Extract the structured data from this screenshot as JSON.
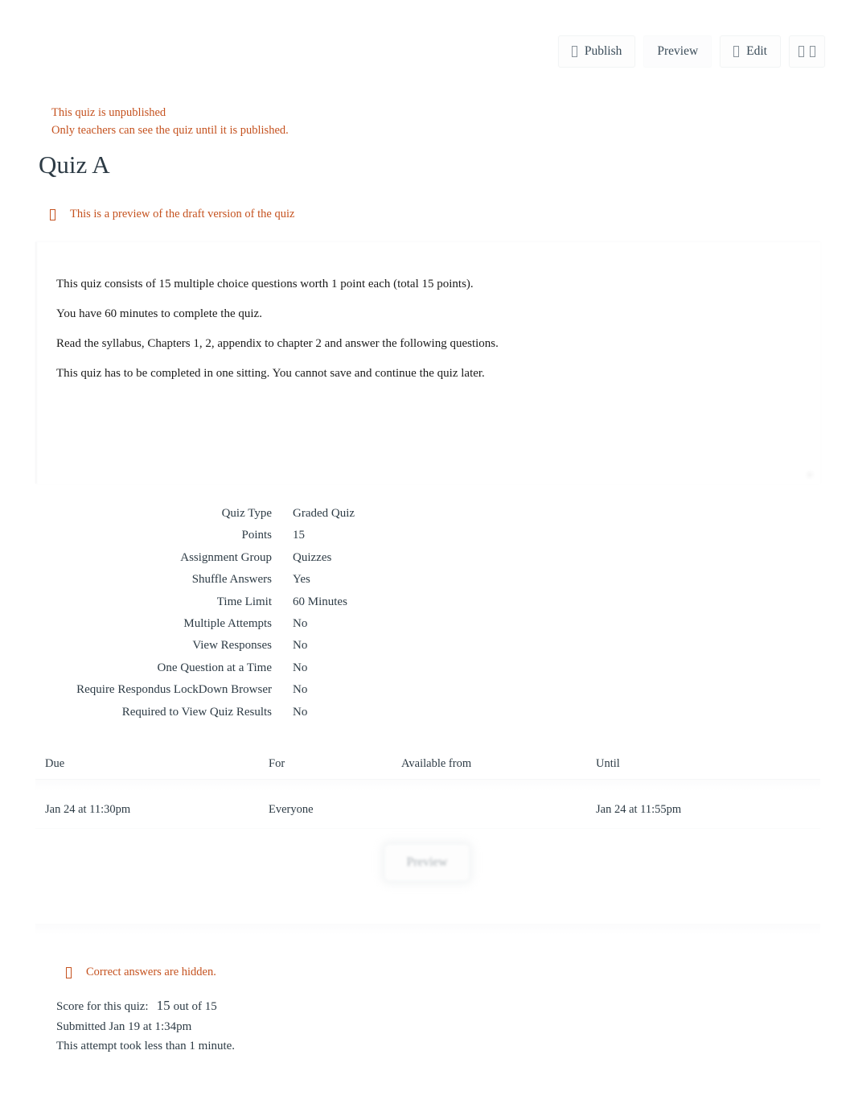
{
  "toolbar": {
    "publish": {
      "label": "Publish",
      "icon": "publish-tofu-icon"
    },
    "preview": {
      "label": "Preview"
    },
    "edit": {
      "label": "Edit",
      "icon": "edit-tofu-icon"
    },
    "overflow": {
      "icon_left": "tofu-icon",
      "icon_right": "tofu-icon"
    }
  },
  "alerts": {
    "unpublished_title": "This quiz is unpublished",
    "unpublished_detail": "Only teachers can see the quiz until it is published.",
    "draft_preview": "This is a preview of the draft version of the quiz",
    "answers_hidden": "Correct answers are hidden.",
    "color": "#c5521f"
  },
  "page_title": "Quiz A",
  "description": [
    "This quiz consists of 15 multiple choice questions worth 1 point each (total 15 points).",
    "You have 60 minutes to complete the quiz.",
    "Read the syllabus, Chapters 1, 2, appendix to chapter 2 and answer the following questions.",
    "This quiz has to be completed in one sitting. You cannot save and continue the quiz later."
  ],
  "details": [
    {
      "label": "Quiz Type",
      "value": "Graded Quiz"
    },
    {
      "label": "Points",
      "value": "15"
    },
    {
      "label": "Assignment Group",
      "value": "Quizzes"
    },
    {
      "label": "Shuffle Answers",
      "value": "Yes"
    },
    {
      "label": "Time Limit",
      "value": "60 Minutes"
    },
    {
      "label": "Multiple Attempts",
      "value": "No"
    },
    {
      "label": "View Responses",
      "value": "No"
    },
    {
      "label": "One Question at a Time",
      "value": "No"
    },
    {
      "label": "Require Respondus LockDown Browser",
      "value": "No"
    },
    {
      "label": "Required to View Quiz Results",
      "value": "No"
    }
  ],
  "dates": {
    "headers": {
      "due": "Due",
      "for": "For",
      "available_from": "Available from",
      "until": "Until"
    },
    "rows": [
      {
        "due": "Jan 24 at 11:30pm",
        "for": "Everyone",
        "available_from": "",
        "until": "Jan 24 at 11:55pm"
      }
    ]
  },
  "preview_button": {
    "label": "Preview"
  },
  "results": {
    "score_label": "Score for this quiz:",
    "score_value": "15",
    "score_out_of": "out of 15",
    "submitted": "Submitted Jan 19 at 1:34pm",
    "duration": "This attempt took less than 1 minute."
  }
}
